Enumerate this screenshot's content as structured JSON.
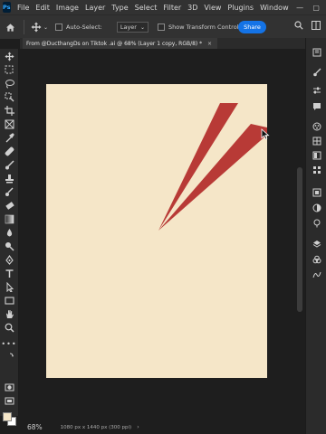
{
  "app": {
    "logo": "Ps"
  },
  "menu": {
    "items": [
      "File",
      "Edit",
      "Image",
      "Layer",
      "Type",
      "Select",
      "Filter",
      "3D",
      "View",
      "Plugins",
      "Window"
    ]
  },
  "window_controls": {
    "minimize": "—",
    "maximize": "▢",
    "close": "✕"
  },
  "options": {
    "auto_select_label": "Auto-Select:",
    "layer_select_value": "Layer",
    "show_transform_label": "Show Transform Controls",
    "more": "•••",
    "share_label": "Share"
  },
  "tab": {
    "title": "From @DucthangDs on Tiktok .ai @ 68% (Layer 1 copy, RGB/8) *",
    "close": "×"
  },
  "status": {
    "zoom": "68%",
    "doc_info": "1080 px x 1440 px (300 ppi)",
    "chevron": "›"
  },
  "colors": {
    "canvas_fill": "#f5e6c8",
    "artwork_red": "#b83a36",
    "accent": "#1473e6",
    "foreground_swatch": "#f5e6c8",
    "background_swatch": "#ffffff"
  },
  "tools": [
    "move-tool",
    "marquee-tool",
    "lasso-tool",
    "object-select-tool",
    "crop-tool",
    "frame-tool",
    "eyedropper-tool",
    "healing-brush-tool",
    "brush-tool",
    "clone-stamp-tool",
    "history-brush-tool",
    "eraser-tool",
    "gradient-tool",
    "blur-tool",
    "dodge-tool",
    "pen-tool",
    "type-tool",
    "path-select-tool",
    "rectangle-tool",
    "hand-tool",
    "zoom-tool",
    "more-tools",
    "quick-mask",
    "screen-mode"
  ],
  "right_panel_icons": [
    "libraries-icon",
    "brush-settings-icon",
    "adjustments-icon",
    "comments-icon",
    "color-icon",
    "swatches-icon",
    "gradients-icon",
    "patterns-icon",
    "properties-icon",
    "adjustments-panel-icon",
    "learn-icon",
    "layers-icon",
    "channels-icon",
    "paths-icon"
  ]
}
